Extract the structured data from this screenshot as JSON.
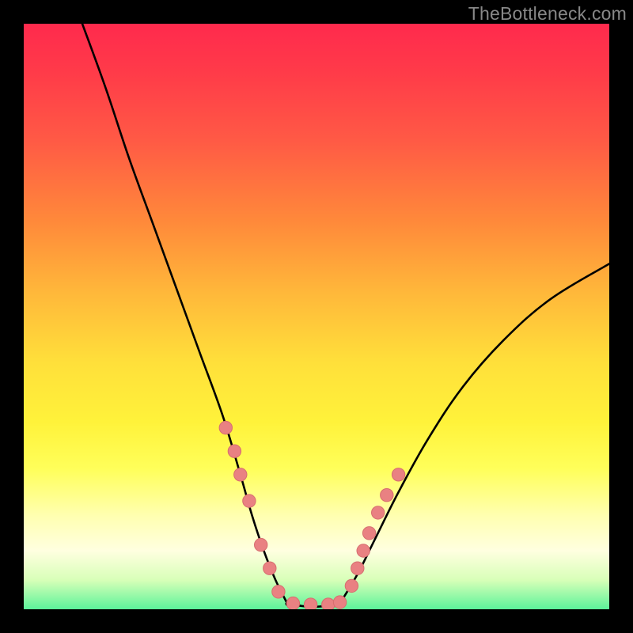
{
  "watermark": "TheBottleneck.com",
  "colors": {
    "frame": "#000000",
    "curve": "#000000",
    "marker_fill": "#e98182",
    "marker_stroke": "#d76e6f",
    "gradient_top": "#ff2a4d",
    "gradient_bottom": "#5cf39a"
  },
  "chart_data": {
    "type": "line",
    "title": "",
    "xlabel": "",
    "ylabel": "",
    "xlim": [
      0,
      100
    ],
    "ylim": [
      0,
      100
    ],
    "series": [
      {
        "name": "left_branch",
        "x": [
          10,
          14,
          18,
          22,
          26,
          30,
          34,
          37,
          39,
          41,
          43,
          45
        ],
        "y": [
          100,
          89,
          77,
          66,
          55,
          44,
          33,
          23,
          16,
          10,
          5,
          1
        ]
      },
      {
        "name": "floor",
        "x": [
          45,
          48,
          51,
          54
        ],
        "y": [
          1,
          0.5,
          0.5,
          1
        ]
      },
      {
        "name": "right_branch",
        "x": [
          54,
          57,
          60,
          64,
          69,
          75,
          82,
          90,
          100
        ],
        "y": [
          1,
          6,
          12,
          20,
          29,
          38,
          46,
          53,
          59
        ]
      }
    ],
    "markers": {
      "name": "data_points",
      "x": [
        34.5,
        36,
        37,
        38.5,
        40.5,
        42,
        43.5,
        46,
        49,
        52,
        54,
        56,
        57,
        58,
        59,
        60.5,
        62,
        64
      ],
      "y": [
        31,
        27,
        23,
        18.5,
        11,
        7,
        3,
        1,
        0.8,
        0.8,
        1.2,
        4,
        7,
        10,
        13,
        16.5,
        19.5,
        23
      ]
    }
  }
}
